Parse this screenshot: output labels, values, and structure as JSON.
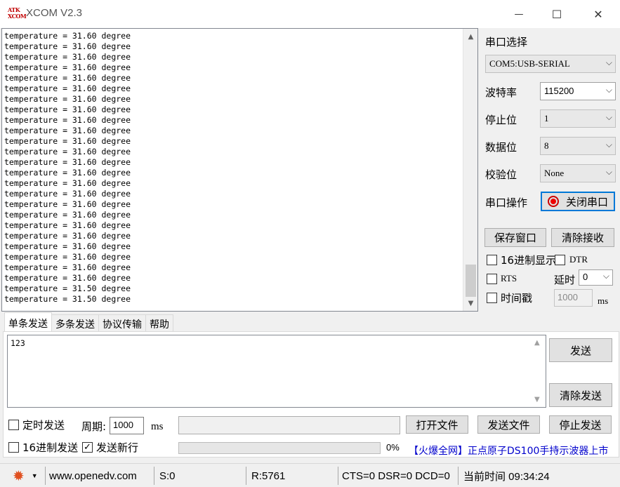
{
  "window": {
    "title": "XCOM V2.3",
    "logo_top": "ATK",
    "logo_bottom": "XCOM",
    "min_glyph": "—",
    "max_glyph": "☐",
    "close_glyph": "✕"
  },
  "receive": {
    "lines": [
      "temperature = 31.60 degree",
      "temperature = 31.60 degree",
      "temperature = 31.60 degree",
      "temperature = 31.60 degree",
      "temperature = 31.60 degree",
      "temperature = 31.60 degree",
      "temperature = 31.60 degree",
      "temperature = 31.60 degree",
      "temperature = 31.60 degree",
      "temperature = 31.60 degree",
      "temperature = 31.60 degree",
      "temperature = 31.60 degree",
      "temperature = 31.60 degree",
      "temperature = 31.60 degree",
      "temperature = 31.60 degree",
      "temperature = 31.60 degree",
      "temperature = 31.60 degree",
      "temperature = 31.60 degree",
      "temperature = 31.60 degree",
      "temperature = 31.60 degree",
      "temperature = 31.60 degree",
      "temperature = 31.60 degree",
      "temperature = 31.60 degree",
      "temperature = 31.60 degree",
      "temperature = 31.50 degree",
      "temperature = 31.50 degree"
    ]
  },
  "settings": {
    "port_select_label": "串口选择",
    "port_value": "COM5:USB-SERIAL",
    "baud_label": "波特率",
    "baud_value": "115200",
    "stop_label": "停止位",
    "stop_value": "1",
    "data_label": "数据位",
    "data_value": "8",
    "parity_label": "校验位",
    "parity_value": "None",
    "port_op_label": "串口操作",
    "close_port_btn": "关闭串口",
    "save_window_btn": "保存窗口",
    "clear_recv_btn": "清除接收",
    "hex_display_label": "16进制显示",
    "dtr_label": "DTR",
    "rts_label": "RTS",
    "delay_label": "延时",
    "delay_value": "0",
    "timestamp_label": "时间戳",
    "timestamp_ms_value": "1000",
    "ms_label": "ms"
  },
  "tabs": [
    "单条发送",
    "多条发送",
    "协议传输",
    "帮助"
  ],
  "send": {
    "input_value": "123",
    "send_btn": "发送",
    "clear_send_btn": "清除发送",
    "timed_send_label": "定时发送",
    "period_label": "周期:",
    "period_value": "1000",
    "period_unit": "ms",
    "file_path_value": "",
    "open_file_btn": "打开文件",
    "send_file_btn": "发送文件",
    "stop_send_btn": "停止发送",
    "hex_send_label": "16进制发送",
    "newline_label": "发送新行",
    "newline_checked_glyph": "✓",
    "progress_percent": 0,
    "progress_text": "0%",
    "promo_text": "【火爆全网】正点原子DS100手持示波器上市"
  },
  "status": {
    "gear_glyph": "✹",
    "caret_glyph": "▼",
    "website": "www.openedv.com",
    "sent": "S:0",
    "received": "R:5761",
    "lines": "CTS=0 DSR=0 DCD=0",
    "time": "当前时间 09:34:24"
  },
  "icons": {
    "scroll_up": "▲",
    "scroll_down": "▼",
    "chevron": "⌵"
  }
}
